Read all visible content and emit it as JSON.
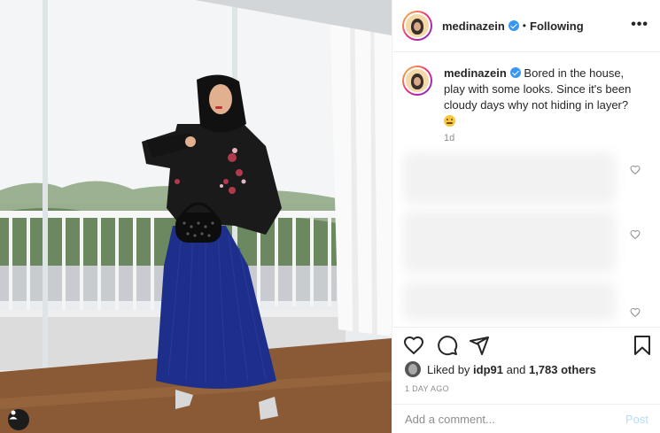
{
  "post": {
    "username": "medinazein",
    "separator": "•",
    "follow_status": "Following",
    "more_label": "•••"
  },
  "caption": {
    "username": "medinazein",
    "text": "Bored in the house, play with some looks. Since it's been cloudy days why not hiding in layer?",
    "time": "1d"
  },
  "likes": {
    "prefix": "Liked by",
    "user": "idp91",
    "joiner": "and",
    "others": "1,783 others"
  },
  "timestamp": "1 DAY AGO",
  "comment": {
    "placeholder": "Add a comment...",
    "post_label": "Post"
  },
  "icons": {
    "more": "more-options-icon",
    "like": "heart-icon",
    "comment": "comment-icon",
    "share": "share-icon",
    "save": "bookmark-icon",
    "verified": "verified-badge-icon",
    "tag": "user-tag-icon"
  },
  "colors": {
    "verified_blue": "#3897f0",
    "post_button_disabled": "#b2dffc",
    "muted_text": "#8e8e8e"
  }
}
